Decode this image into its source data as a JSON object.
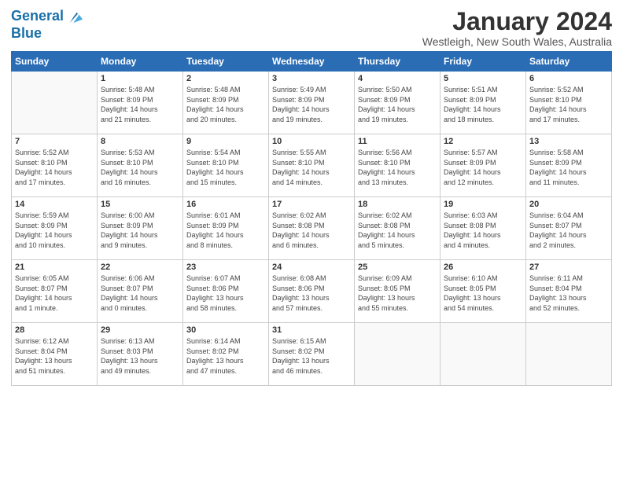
{
  "logo": {
    "line1": "General",
    "line2": "Blue"
  },
  "title": "January 2024",
  "location": "Westleigh, New South Wales, Australia",
  "weekdays": [
    "Sunday",
    "Monday",
    "Tuesday",
    "Wednesday",
    "Thursday",
    "Friday",
    "Saturday"
  ],
  "weeks": [
    [
      {
        "day": "",
        "info": ""
      },
      {
        "day": "1",
        "info": "Sunrise: 5:48 AM\nSunset: 8:09 PM\nDaylight: 14 hours\nand 21 minutes."
      },
      {
        "day": "2",
        "info": "Sunrise: 5:48 AM\nSunset: 8:09 PM\nDaylight: 14 hours\nand 20 minutes."
      },
      {
        "day": "3",
        "info": "Sunrise: 5:49 AM\nSunset: 8:09 PM\nDaylight: 14 hours\nand 19 minutes."
      },
      {
        "day": "4",
        "info": "Sunrise: 5:50 AM\nSunset: 8:09 PM\nDaylight: 14 hours\nand 19 minutes."
      },
      {
        "day": "5",
        "info": "Sunrise: 5:51 AM\nSunset: 8:09 PM\nDaylight: 14 hours\nand 18 minutes."
      },
      {
        "day": "6",
        "info": "Sunrise: 5:52 AM\nSunset: 8:10 PM\nDaylight: 14 hours\nand 17 minutes."
      }
    ],
    [
      {
        "day": "7",
        "info": "Sunrise: 5:52 AM\nSunset: 8:10 PM\nDaylight: 14 hours\nand 17 minutes."
      },
      {
        "day": "8",
        "info": "Sunrise: 5:53 AM\nSunset: 8:10 PM\nDaylight: 14 hours\nand 16 minutes."
      },
      {
        "day": "9",
        "info": "Sunrise: 5:54 AM\nSunset: 8:10 PM\nDaylight: 14 hours\nand 15 minutes."
      },
      {
        "day": "10",
        "info": "Sunrise: 5:55 AM\nSunset: 8:10 PM\nDaylight: 14 hours\nand 14 minutes."
      },
      {
        "day": "11",
        "info": "Sunrise: 5:56 AM\nSunset: 8:10 PM\nDaylight: 14 hours\nand 13 minutes."
      },
      {
        "day": "12",
        "info": "Sunrise: 5:57 AM\nSunset: 8:09 PM\nDaylight: 14 hours\nand 12 minutes."
      },
      {
        "day": "13",
        "info": "Sunrise: 5:58 AM\nSunset: 8:09 PM\nDaylight: 14 hours\nand 11 minutes."
      }
    ],
    [
      {
        "day": "14",
        "info": "Sunrise: 5:59 AM\nSunset: 8:09 PM\nDaylight: 14 hours\nand 10 minutes."
      },
      {
        "day": "15",
        "info": "Sunrise: 6:00 AM\nSunset: 8:09 PM\nDaylight: 14 hours\nand 9 minutes."
      },
      {
        "day": "16",
        "info": "Sunrise: 6:01 AM\nSunset: 8:09 PM\nDaylight: 14 hours\nand 8 minutes."
      },
      {
        "day": "17",
        "info": "Sunrise: 6:02 AM\nSunset: 8:08 PM\nDaylight: 14 hours\nand 6 minutes."
      },
      {
        "day": "18",
        "info": "Sunrise: 6:02 AM\nSunset: 8:08 PM\nDaylight: 14 hours\nand 5 minutes."
      },
      {
        "day": "19",
        "info": "Sunrise: 6:03 AM\nSunset: 8:08 PM\nDaylight: 14 hours\nand 4 minutes."
      },
      {
        "day": "20",
        "info": "Sunrise: 6:04 AM\nSunset: 8:07 PM\nDaylight: 14 hours\nand 2 minutes."
      }
    ],
    [
      {
        "day": "21",
        "info": "Sunrise: 6:05 AM\nSunset: 8:07 PM\nDaylight: 14 hours\nand 1 minute."
      },
      {
        "day": "22",
        "info": "Sunrise: 6:06 AM\nSunset: 8:07 PM\nDaylight: 14 hours\nand 0 minutes."
      },
      {
        "day": "23",
        "info": "Sunrise: 6:07 AM\nSunset: 8:06 PM\nDaylight: 13 hours\nand 58 minutes."
      },
      {
        "day": "24",
        "info": "Sunrise: 6:08 AM\nSunset: 8:06 PM\nDaylight: 13 hours\nand 57 minutes."
      },
      {
        "day": "25",
        "info": "Sunrise: 6:09 AM\nSunset: 8:05 PM\nDaylight: 13 hours\nand 55 minutes."
      },
      {
        "day": "26",
        "info": "Sunrise: 6:10 AM\nSunset: 8:05 PM\nDaylight: 13 hours\nand 54 minutes."
      },
      {
        "day": "27",
        "info": "Sunrise: 6:11 AM\nSunset: 8:04 PM\nDaylight: 13 hours\nand 52 minutes."
      }
    ],
    [
      {
        "day": "28",
        "info": "Sunrise: 6:12 AM\nSunset: 8:04 PM\nDaylight: 13 hours\nand 51 minutes."
      },
      {
        "day": "29",
        "info": "Sunrise: 6:13 AM\nSunset: 8:03 PM\nDaylight: 13 hours\nand 49 minutes."
      },
      {
        "day": "30",
        "info": "Sunrise: 6:14 AM\nSunset: 8:02 PM\nDaylight: 13 hours\nand 47 minutes."
      },
      {
        "day": "31",
        "info": "Sunrise: 6:15 AM\nSunset: 8:02 PM\nDaylight: 13 hours\nand 46 minutes."
      },
      {
        "day": "",
        "info": ""
      },
      {
        "day": "",
        "info": ""
      },
      {
        "day": "",
        "info": ""
      }
    ]
  ]
}
